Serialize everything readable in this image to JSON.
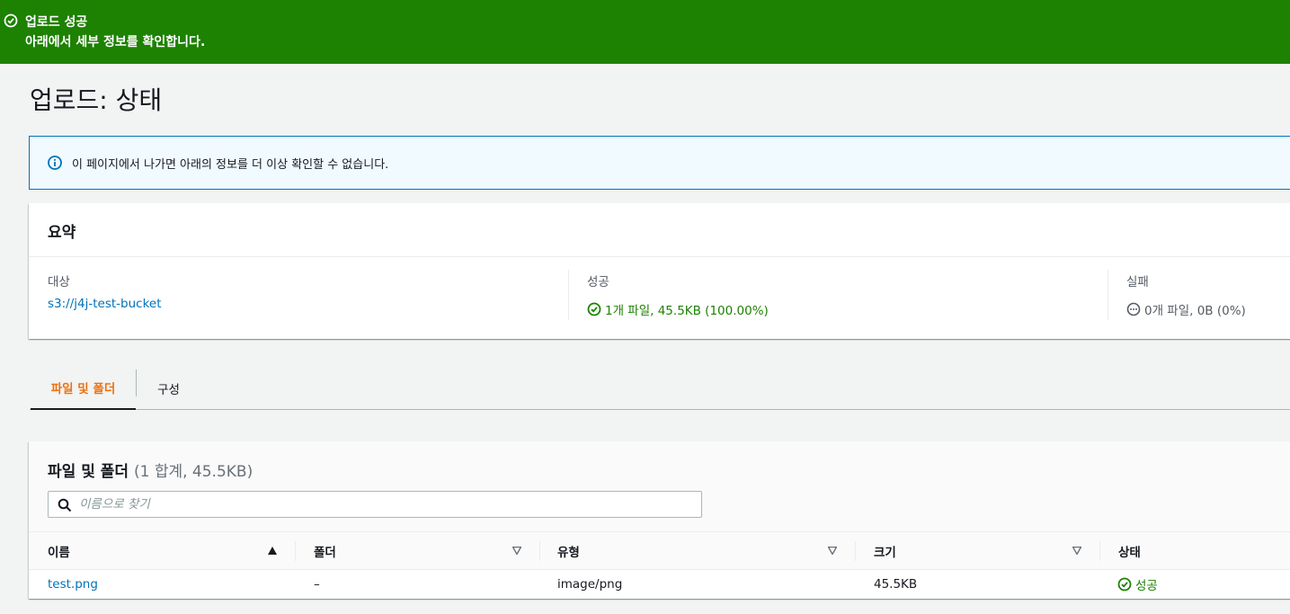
{
  "flash": {
    "title": "업로드 성공",
    "message": "아래에서 세부 정보를 확인합니다.",
    "color": "#1d8102"
  },
  "page": {
    "title": "업로드: 상태"
  },
  "alert": {
    "text": "이 페이지에서 나가면 아래의 정보를 더 이상 확인할 수 없습니다."
  },
  "summary": {
    "title": "요약",
    "destination": {
      "label": "대상",
      "value": "s3://j4j-test-bucket"
    },
    "succeeded": {
      "label": "성공",
      "value": "1개 파일, 45.5KB (100.00%)"
    },
    "failed": {
      "label": "실패",
      "value": "0개 파일, 0B (0%)"
    }
  },
  "tabs": [
    {
      "label": "파일 및 폴더",
      "active": true
    },
    {
      "label": "구성",
      "active": false
    }
  ],
  "files": {
    "title": "파일 및 폴더",
    "count": "(1 합계, 45.5KB)",
    "search_placeholder": "이름으로 찾기",
    "columns": [
      "이름",
      "폴더",
      "유형",
      "크기",
      "상태"
    ],
    "rows": [
      {
        "name": "test.png",
        "folder": "–",
        "type": "image/png",
        "size": "45.5KB",
        "status": "성공"
      }
    ]
  }
}
